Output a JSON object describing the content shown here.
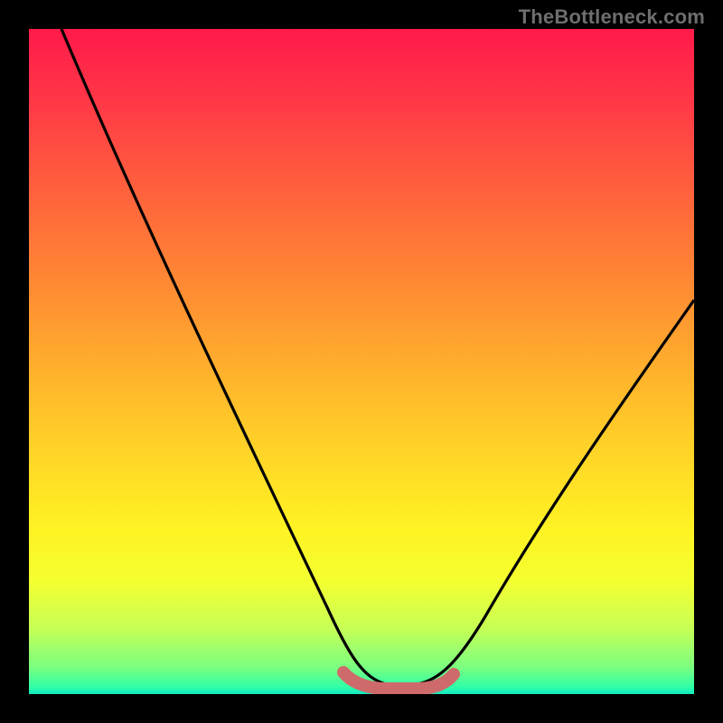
{
  "watermark": "TheBottleneck.com",
  "chart_data": {
    "type": "line",
    "title": "",
    "xlabel": "",
    "ylabel": "",
    "legend": false,
    "grid": false,
    "xlim": [
      0,
      100
    ],
    "ylim": [
      0,
      100
    ],
    "series": [
      {
        "name": "bottleneck-curve",
        "color": "#000000",
        "x": [
          5,
          10,
          15,
          20,
          25,
          30,
          35,
          40,
          45,
          48,
          50,
          52,
          55,
          58,
          60,
          65,
          70,
          75,
          80,
          85,
          90,
          95,
          100
        ],
        "y": [
          100,
          91,
          83,
          74,
          65,
          55,
          45,
          35,
          23,
          12,
          5,
          2,
          0,
          0,
          2,
          7,
          15,
          23,
          31,
          39,
          47,
          54,
          60
        ]
      },
      {
        "name": "highlight-band",
        "color": "#cf6a6a",
        "x": [
          48,
          50,
          52,
          55,
          58,
          60
        ],
        "y": [
          3,
          2,
          1,
          1,
          2,
          3
        ]
      }
    ],
    "background": {
      "type": "vertical-gradient",
      "stops": [
        {
          "pos": 0.0,
          "color": "#ff1a4a"
        },
        {
          "pos": 0.5,
          "color": "#ffb028"
        },
        {
          "pos": 0.8,
          "color": "#fff223"
        },
        {
          "pos": 1.0,
          "color": "#10e8c2"
        }
      ]
    }
  }
}
